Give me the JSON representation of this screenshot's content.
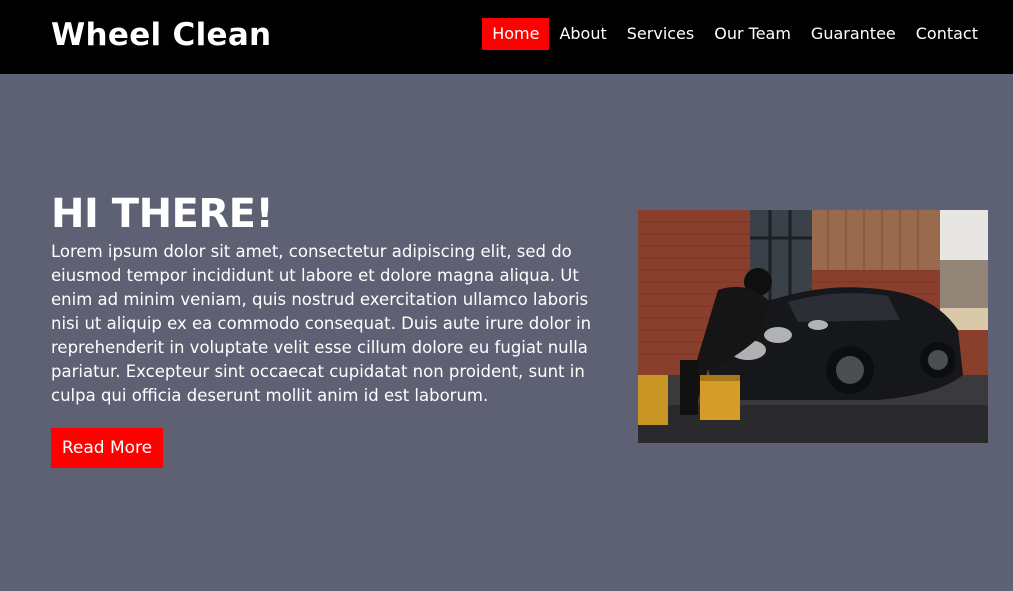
{
  "header": {
    "brand": "Wheel Clean",
    "nav": [
      {
        "label": "Home",
        "active": true
      },
      {
        "label": "About",
        "active": false
      },
      {
        "label": "Services",
        "active": false
      },
      {
        "label": "Our Team",
        "active": false
      },
      {
        "label": "Guarantee",
        "active": false
      },
      {
        "label": "Contact",
        "active": false
      }
    ]
  },
  "hero": {
    "title": "HI THERE!",
    "body": "Lorem ipsum dolor sit amet, consectetur adipiscing elit, sed do eiusmod tempor incididunt ut labore et dolore magna aliqua. Ut enim ad minim veniam, quis nostrud exercitation ullamco laboris nisi ut aliquip ex ea commodo consequat. Duis aute irure dolor in reprehenderit in voluptate velit esse cillum dolore eu fugiat nulla pariatur. Excepteur sint occaecat cupidatat non proident, sunt in culpa qui officia deserunt mollit anim id est laborum.",
    "button_label": "Read More",
    "image": "car-wash-photo"
  },
  "colors": {
    "navbar": "#000000",
    "background": "#5d6173",
    "accent": "#ff0000",
    "text": "#ffffff"
  }
}
